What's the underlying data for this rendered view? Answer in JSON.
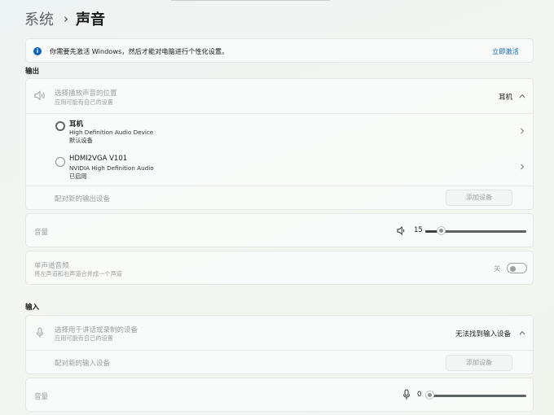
{
  "breadcrumb": {
    "parent": "系统",
    "separator": "›",
    "current": "声音"
  },
  "activation_banner": {
    "message": "你需要先激活 Windows，然后才能对电脑进行个性化设置。",
    "action": "立即激活"
  },
  "output": {
    "section_title": "输出",
    "chooser": {
      "title": "选择播放声音的位置",
      "subtitle": "应用可能有自己的设置",
      "selected": "耳机"
    },
    "devices": [
      {
        "name": "耳机",
        "detail": "High Definition Audio Device",
        "status": "默认设备",
        "selected": true
      },
      {
        "name": "HDMI2VGA V101",
        "detail": "NVIDIA High Definition Audio",
        "status": "已启用",
        "selected": false
      }
    ],
    "pair": {
      "label": "配对新的输出设备",
      "button": "添加设备"
    },
    "volume": {
      "label": "音量",
      "value": "15",
      "level": 0.15
    },
    "mono": {
      "title": "单声道音频",
      "subtitle": "将左声道和右声道合并成一个声道",
      "state": "关"
    }
  },
  "input": {
    "section_title": "输入",
    "chooser": {
      "title": "选择用于讲话或录制的设备",
      "subtitle": "应用可能有自己的设置",
      "selected": "无法找到输入设备"
    },
    "pair": {
      "label": "配对新的输入设备",
      "button": "添加设备"
    },
    "volume": {
      "label": "音量",
      "value": "0",
      "level": 0
    }
  },
  "icons": {
    "info": "info-icon",
    "speaker": "speaker-icon",
    "microphone": "microphone-icon",
    "chevron_up": "chevron-up-icon",
    "chevron_right": "chevron-right-icon"
  },
  "colors": {
    "accent": "#0a64c2",
    "link": "#0a5fb3"
  }
}
